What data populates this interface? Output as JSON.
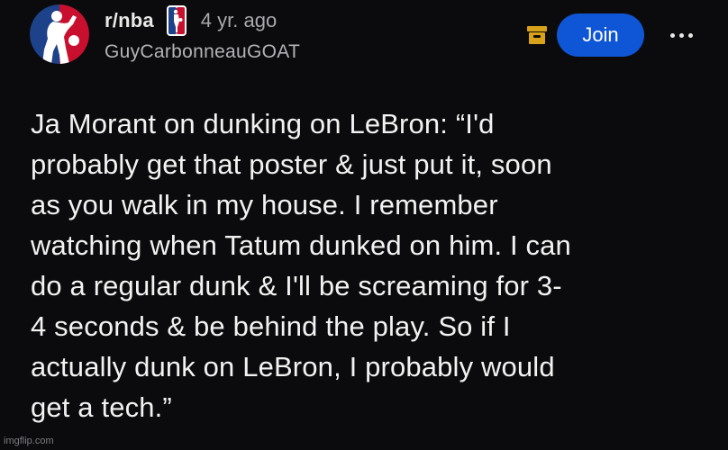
{
  "subreddit": {
    "name": "r/nba",
    "icon": "nba-logo-icon",
    "flair_icon": "nba-logo-icon"
  },
  "post": {
    "age": "4 yr. ago",
    "author": "GuyCarbonneauGOAT",
    "title_lines": [
      "Ja Morant on dunking on LeBron: “I'd",
      "probably get that poster & just put it, soon",
      "as you walk in my house. I remember",
      "watching when Tatum dunked on him. I can",
      "do a regular dunk & I'll be screaming for 3-",
      "4 seconds & be behind the play. So if I",
      "actually dunk on LeBron, I probably would",
      "get a tech.”"
    ]
  },
  "actions": {
    "archive_icon": "archive-icon",
    "join_label": "Join",
    "more_icon": "more-horizontal-icon"
  },
  "watermark": "imgflip.com",
  "colors": {
    "background": "#0b0b0d",
    "join_button": "#0f56d6",
    "archive_icon": "#d9a21b",
    "nba_red": "#c8102e",
    "nba_blue": "#1d428a"
  }
}
